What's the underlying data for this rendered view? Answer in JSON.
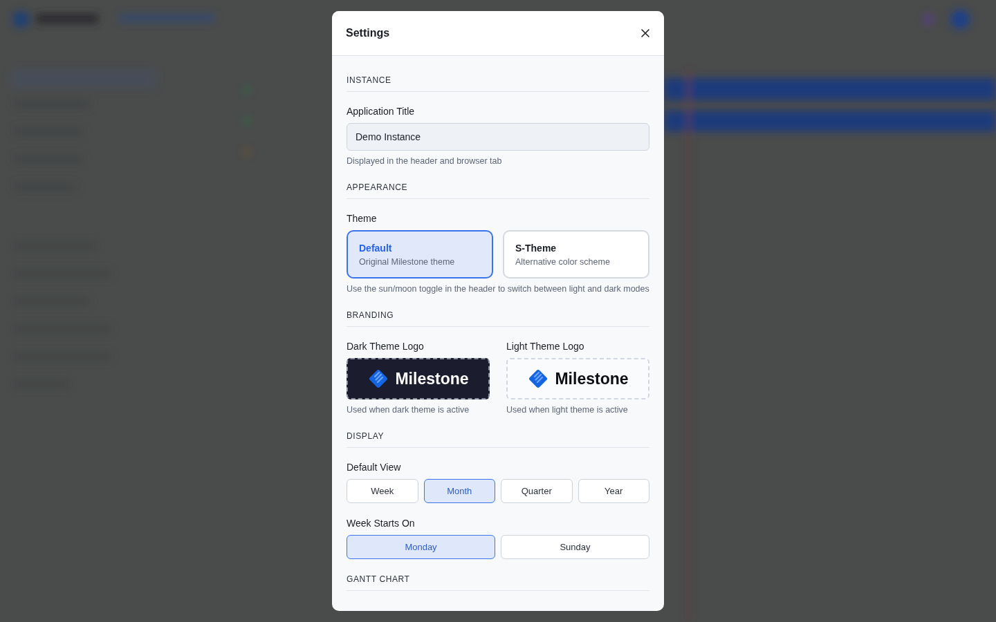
{
  "dialog": {
    "title": "Settings",
    "sections": [
      {
        "heading": "INSTANCE",
        "items": [
          {
            "kind": "text",
            "label": "Application Title",
            "value": "Demo Instance",
            "hint": "Displayed in the header and browser tab"
          }
        ]
      },
      {
        "heading": "APPEARANCE",
        "items": [
          {
            "kind": "cards",
            "label": "Theme",
            "hint": "Use the sun/moon toggle in the header to switch between light and dark modes",
            "options": [
              {
                "title": "Default",
                "subtitle": "Original Milestone theme",
                "selected": true
              },
              {
                "title": "S-Theme",
                "subtitle": "Alternative color scheme",
                "selected": false
              }
            ]
          }
        ]
      },
      {
        "heading": "BRANDING",
        "items": [
          {
            "kind": "logos",
            "logos": [
              {
                "label": "Dark Theme Logo",
                "kind": "dark",
                "logo_text": "Milestone",
                "hint": "Used when dark theme is active"
              },
              {
                "label": "Light Theme Logo",
                "kind": "light",
                "logo_text": "Milestone",
                "hint": "Used when light theme is active"
              }
            ]
          }
        ]
      },
      {
        "heading": "DISPLAY",
        "items": [
          {
            "kind": "segmented",
            "label": "Default View",
            "options": [
              {
                "label": "Week",
                "selected": false
              },
              {
                "label": "Month",
                "selected": true
              },
              {
                "label": "Quarter",
                "selected": false
              },
              {
                "label": "Year",
                "selected": false
              }
            ]
          },
          {
            "kind": "segmented",
            "label": "Week Starts On",
            "options": [
              {
                "label": "Monday",
                "selected": true
              },
              {
                "label": "Sunday",
                "selected": false
              }
            ]
          }
        ]
      },
      {
        "heading": "GANTT CHART"
      }
    ]
  }
}
